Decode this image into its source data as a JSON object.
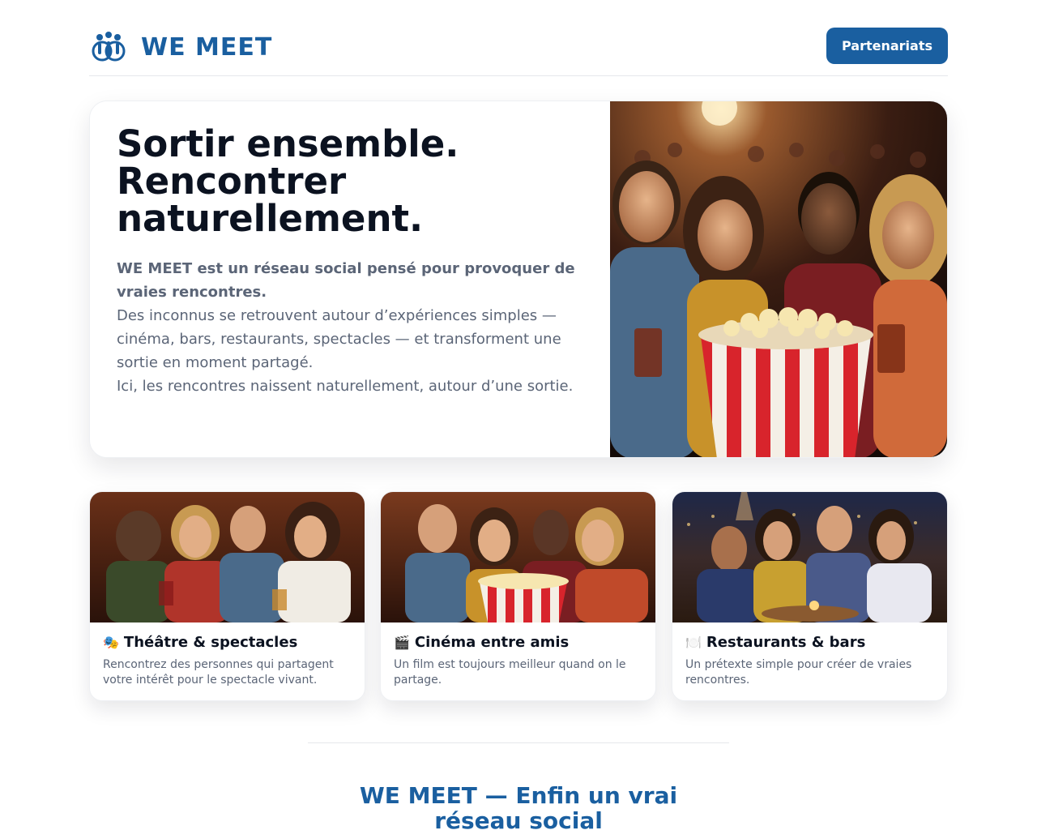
{
  "header": {
    "brand": "WE MEET",
    "partners_button": "Partenariats"
  },
  "hero": {
    "title_line1": "Sortir ensemble.",
    "title_line2": "Rencontrer",
    "title_line3": "naturellement.",
    "lead": "WE MEET est un réseau social pensé pour provoquer de vraies rencontres.",
    "paragraph1": "Des inconnus se retrouvent autour d’expériences simples — cinéma, bars, restaurants, spectacles — et transforment une sortie en moment partagé.",
    "paragraph2": "Ici, les rencontres naissent naturellement, autour d’une sortie."
  },
  "cards": [
    {
      "emoji": "🎭",
      "icon": "theatre-masks-icon",
      "title": "Théâtre & spectacles",
      "description": "Rencontrez des personnes qui partagent votre intérêt pour le spectacle vivant."
    },
    {
      "emoji": "🎬",
      "icon": "clapperboard-icon",
      "title": "Cinéma entre amis",
      "description": "Un film est toujours meilleur quand on le partage."
    },
    {
      "emoji": "🍽️",
      "icon": "fork-knife-icon",
      "title": "Restaurants & bars",
      "description": "Un prétexte simple pour créer de vraies rencontres."
    }
  ],
  "footer": {
    "title": "WE MEET — Enfin un vrai réseau social"
  },
  "colors": {
    "brand": "#1a5fa0",
    "heading": "#0b1220",
    "body_text": "#5b6577"
  }
}
